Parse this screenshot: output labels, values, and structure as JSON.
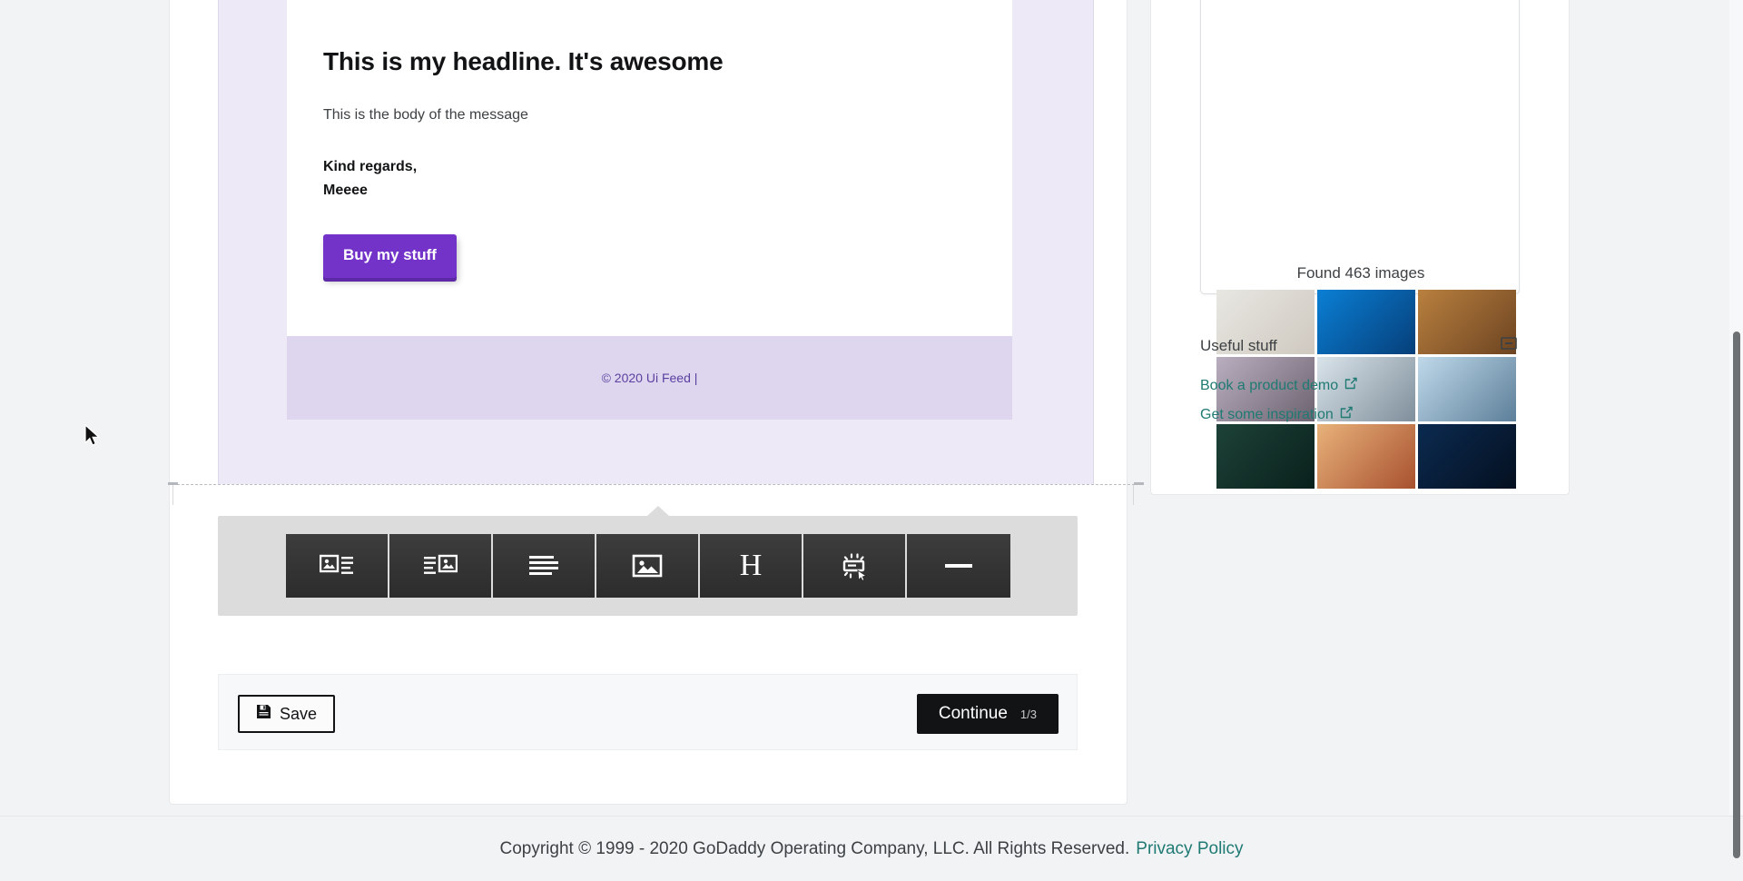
{
  "email": {
    "headline": "This is my headline. It's awesome",
    "body": "This is the body of the message",
    "signoff_line1": "Kind regards,",
    "signoff_line2": "Meeee",
    "cta_label": "Buy my stuff",
    "footer_text": "© 2020 Ui Feed |",
    "accent_color": "#7333c9",
    "footer_bg": "#ded6ef",
    "canvas_bg": "#ede9f7"
  },
  "toolbar": {
    "buttons": [
      {
        "name": "image-left-layout",
        "icon": "image-left-icon"
      },
      {
        "name": "image-right-layout",
        "icon": "image-right-icon"
      },
      {
        "name": "text-only-layout",
        "icon": "text-lines-icon"
      },
      {
        "name": "image-only-layout",
        "icon": "image-icon"
      },
      {
        "name": "heading-block",
        "icon": "heading-icon",
        "label": "H"
      },
      {
        "name": "button-block",
        "icon": "button-click-icon"
      },
      {
        "name": "divider-block",
        "icon": "divider-icon"
      }
    ]
  },
  "actions": {
    "save_label": "Save",
    "save_icon": "floppy-disk-icon",
    "continue_label": "Continue",
    "continue_count": "1/3"
  },
  "sidebar": {
    "images_found": "Found 463 images",
    "thumbnails": [
      {
        "alt": "hand-on-keyboard",
        "c1": "#e8e7e2",
        "c2": "#cfc9c0"
      },
      {
        "alt": "blue-circuit-board",
        "c1": "#0a7fd4",
        "c2": "#063f7a"
      },
      {
        "alt": "desk-tablet-phone-coffee",
        "c1": "#b9803f",
        "c2": "#6d4421"
      },
      {
        "alt": "tablet-with-charts",
        "c1": "#b9aebf",
        "c2": "#6c6370"
      },
      {
        "alt": "hands-typing-keyboard",
        "c1": "#d9e3ea",
        "c2": "#7f8f9b"
      },
      {
        "alt": "finger-touching-interface",
        "c1": "#bfd9ea",
        "c2": "#5d7f99"
      },
      {
        "alt": "server-racks",
        "c1": "#1d4238",
        "c2": "#09201b"
      },
      {
        "alt": "phone-with-bokeh-lights",
        "c1": "#e8b27a",
        "c2": "#a8512f"
      },
      {
        "alt": "cyber-security-icons",
        "c1": "#0b2a50",
        "c2": "#04101f"
      }
    ],
    "useful_stuff_title": "Useful stuff",
    "collapse_icon": "minimize-icon",
    "links": [
      {
        "label": "Book a product demo",
        "icon": "external-link-icon"
      },
      {
        "label": "Get some inspiration",
        "icon": "external-link-icon"
      }
    ],
    "link_color": "#1f7a73"
  },
  "footer": {
    "copyright": "Copyright © 1999 - 2020 GoDaddy Operating Company, LLC. All Rights Reserved.",
    "privacy_label": "Privacy Policy"
  }
}
